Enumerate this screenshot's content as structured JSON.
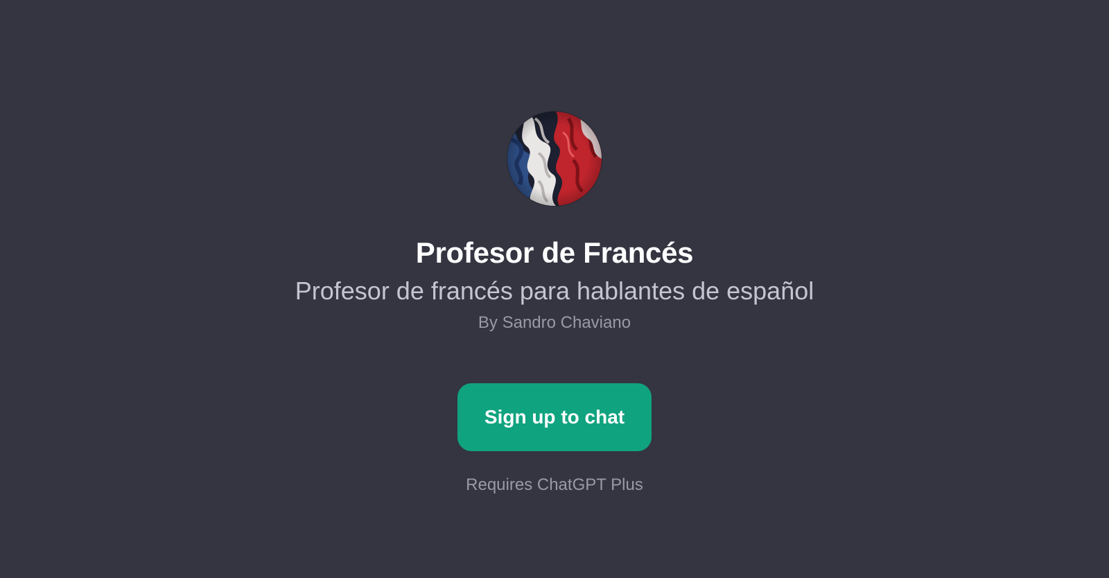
{
  "gpt": {
    "avatar_icon": "french-flag-fabric-avatar",
    "title": "Profesor de Francés",
    "description": "Profesor de francés para hablantes de español",
    "author": "By Sandro Chaviano"
  },
  "actions": {
    "signup_label": "Sign up to chat",
    "requirement": "Requires ChatGPT Plus"
  },
  "colors": {
    "background": "#343541",
    "accent": "#10a37f",
    "title": "#ffffff",
    "subtitle": "#c5c5d2",
    "muted": "#9a9aa6",
    "flag_blue": "#2f4f86",
    "flag_white": "#e9e6e6",
    "flag_red": "#c0242c"
  }
}
